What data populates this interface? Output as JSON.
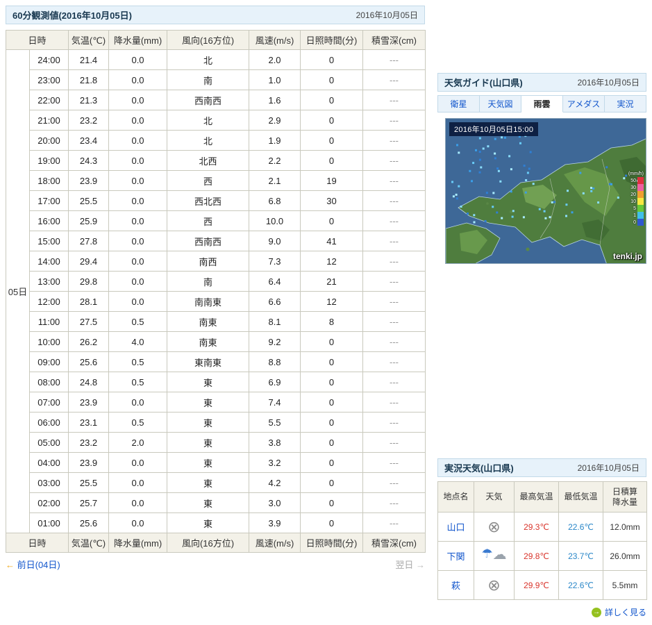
{
  "observation": {
    "title": "60分観測値(2016年10月05日)",
    "date": "2016年10月05日",
    "day_label": "05日",
    "columns": [
      "日時",
      "気温(℃)",
      "降水量(mm)",
      "風向(16方位)",
      "風速(m/s)",
      "日照時間(分)",
      "積雪深(cm)"
    ],
    "rows": [
      {
        "time": "24:00",
        "temp": "21.4",
        "precip": "0.0",
        "dir": "北",
        "speed": "2.0",
        "sun": "0",
        "snow": "---"
      },
      {
        "time": "23:00",
        "temp": "21.8",
        "precip": "0.0",
        "dir": "南",
        "speed": "1.0",
        "sun": "0",
        "snow": "---"
      },
      {
        "time": "22:00",
        "temp": "21.3",
        "precip": "0.0",
        "dir": "西南西",
        "speed": "1.6",
        "sun": "0",
        "snow": "---"
      },
      {
        "time": "21:00",
        "temp": "23.2",
        "precip": "0.0",
        "dir": "北",
        "speed": "2.9",
        "sun": "0",
        "snow": "---"
      },
      {
        "time": "20:00",
        "temp": "23.4",
        "precip": "0.0",
        "dir": "北",
        "speed": "1.9",
        "sun": "0",
        "snow": "---"
      },
      {
        "time": "19:00",
        "temp": "24.3",
        "precip": "0.0",
        "dir": "北西",
        "speed": "2.2",
        "sun": "0",
        "snow": "---"
      },
      {
        "time": "18:00",
        "temp": "23.9",
        "precip": "0.0",
        "dir": "西",
        "speed": "2.1",
        "sun": "19",
        "snow": "---"
      },
      {
        "time": "17:00",
        "temp": "25.5",
        "precip": "0.0",
        "dir": "西北西",
        "speed": "6.8",
        "sun": "30",
        "snow": "---"
      },
      {
        "time": "16:00",
        "temp": "25.9",
        "precip": "0.0",
        "dir": "西",
        "speed": "10.0",
        "sun": "0",
        "snow": "---"
      },
      {
        "time": "15:00",
        "temp": "27.8",
        "precip": "0.0",
        "dir": "西南西",
        "speed": "9.0",
        "sun": "41",
        "snow": "---"
      },
      {
        "time": "14:00",
        "temp": "29.4",
        "precip": "0.0",
        "dir": "南西",
        "speed": "7.3",
        "sun": "12",
        "snow": "---"
      },
      {
        "time": "13:00",
        "temp": "29.8",
        "precip": "0.0",
        "dir": "南",
        "speed": "6.4",
        "sun": "21",
        "snow": "---"
      },
      {
        "time": "12:00",
        "temp": "28.1",
        "precip": "0.0",
        "dir": "南南東",
        "speed": "6.6",
        "sun": "12",
        "snow": "---"
      },
      {
        "time": "11:00",
        "temp": "27.5",
        "precip": "0.5",
        "dir": "南東",
        "speed": "8.1",
        "sun": "8",
        "snow": "---"
      },
      {
        "time": "10:00",
        "temp": "26.2",
        "precip": "4.0",
        "dir": "南東",
        "speed": "9.2",
        "sun": "0",
        "snow": "---"
      },
      {
        "time": "09:00",
        "temp": "25.6",
        "precip": "0.5",
        "dir": "東南東",
        "speed": "8.8",
        "sun": "0",
        "snow": "---"
      },
      {
        "time": "08:00",
        "temp": "24.8",
        "precip": "0.5",
        "dir": "東",
        "speed": "6.9",
        "sun": "0",
        "snow": "---"
      },
      {
        "time": "07:00",
        "temp": "23.9",
        "precip": "0.0",
        "dir": "東",
        "speed": "7.4",
        "sun": "0",
        "snow": "---"
      },
      {
        "time": "06:00",
        "temp": "23.1",
        "precip": "0.5",
        "dir": "東",
        "speed": "5.5",
        "sun": "0",
        "snow": "---"
      },
      {
        "time": "05:00",
        "temp": "23.2",
        "precip": "2.0",
        "dir": "東",
        "speed": "3.8",
        "sun": "0",
        "snow": "---"
      },
      {
        "time": "04:00",
        "temp": "23.9",
        "precip": "0.0",
        "dir": "東",
        "speed": "3.2",
        "sun": "0",
        "snow": "---"
      },
      {
        "time": "03:00",
        "temp": "25.5",
        "precip": "0.0",
        "dir": "東",
        "speed": "4.2",
        "sun": "0",
        "snow": "---"
      },
      {
        "time": "02:00",
        "temp": "25.7",
        "precip": "0.0",
        "dir": "東",
        "speed": "3.0",
        "sun": "0",
        "snow": "---"
      },
      {
        "time": "01:00",
        "temp": "25.6",
        "precip": "0.0",
        "dir": "東",
        "speed": "3.9",
        "sun": "0",
        "snow": "---"
      }
    ],
    "prev_arrow": "←",
    "prev_label": "前日(04日)",
    "next_label": "翌日",
    "next_arrow": "→"
  },
  "guide": {
    "title": "天気ガイド(山口県)",
    "date": "2016年10月05日",
    "tabs": [
      "衛星",
      "天気図",
      "雨雲",
      "アメダス",
      "実況"
    ],
    "active_tab": "雨雲",
    "map": {
      "timestamp": "2016年10月05日15:00",
      "legend_unit": "(mm/h)",
      "legend_values": [
        "50",
        "30",
        "20",
        "10",
        "5",
        "1",
        "0"
      ],
      "watermark": "tenki.jp"
    }
  },
  "current": {
    "title": "実況天気(山口県)",
    "date": "2016年10月05日",
    "columns": [
      "地点名",
      "天気",
      "最高気温",
      "最低気温",
      "日積算\n降水量"
    ],
    "rows": [
      {
        "name": "山口",
        "icon": "unknown-weather-icon",
        "high": "29.3℃",
        "low": "22.6℃",
        "precip": "12.0mm"
      },
      {
        "name": "下関",
        "icon": "rain-cloud-weather-icon",
        "high": "29.8℃",
        "low": "23.7℃",
        "precip": "26.0mm"
      },
      {
        "name": "萩",
        "icon": "unknown-weather-icon",
        "high": "29.9℃",
        "low": "22.6℃",
        "precip": "5.5mm"
      }
    ],
    "more_label": "詳しく見る"
  },
  "colors": {
    "high_temp": "#d9342b",
    "low_temp": "#2a87c8",
    "link": "#1155cc",
    "header_bg": "#e7f2fa"
  }
}
